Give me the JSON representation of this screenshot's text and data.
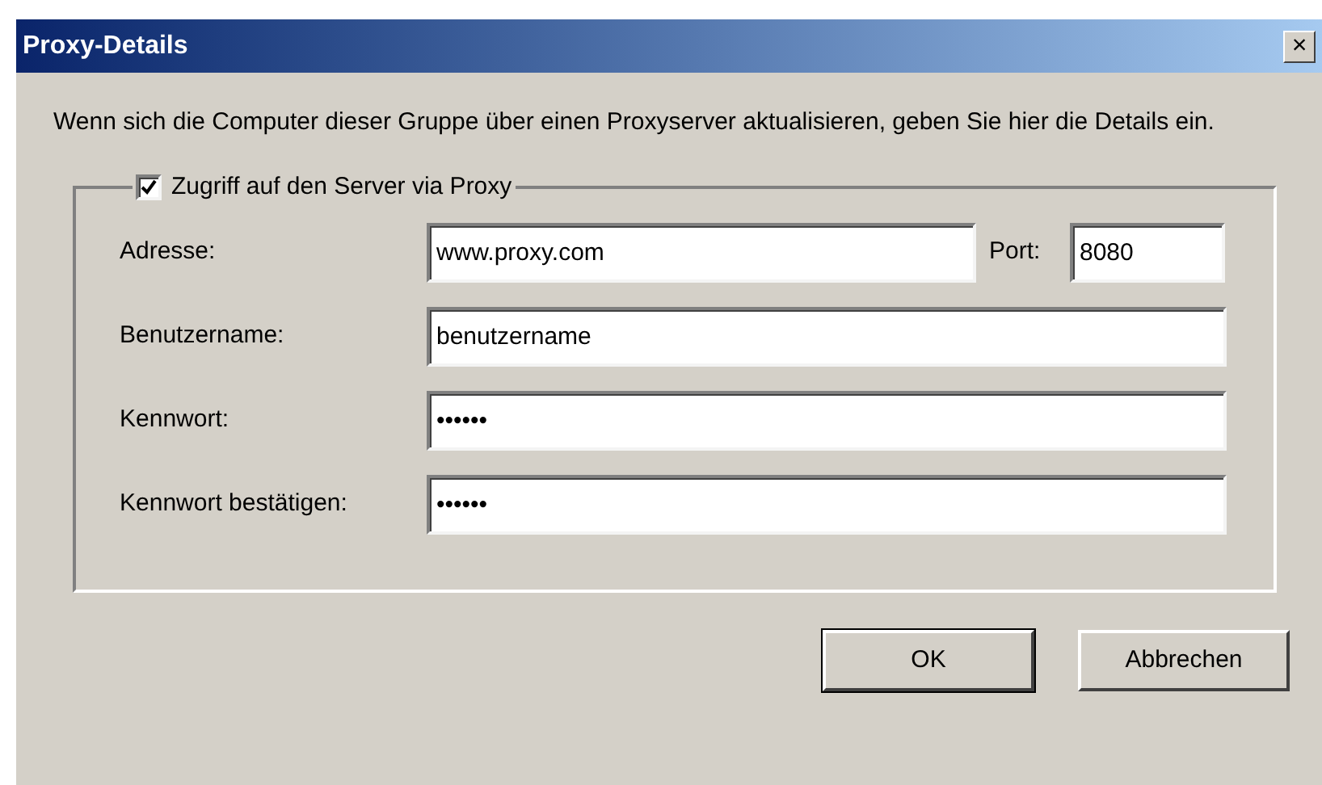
{
  "window": {
    "title": "Proxy-Details",
    "close": "×"
  },
  "description": "Wenn sich die Computer dieser Gruppe über einen Proxyserver aktualisieren, geben Sie hier die Details ein.",
  "group": {
    "label": "Zugriff auf den Server via Proxy",
    "checked": true
  },
  "fields": [
    {
      "label": "Adresse:",
      "value": "www.proxy.com",
      "port": {
        "label": "Port:",
        "value": "8080"
      }
    },
    {
      "label": "Benutzername:",
      "value": "benutzername"
    },
    {
      "label": "Kennwort:",
      "value": "••••••"
    },
    {
      "label": "Kennwort bestätigen:",
      "value": "••••••"
    }
  ],
  "buttons": [
    {
      "label": "OK",
      "kind": "default"
    },
    {
      "label": "Abbrechen",
      "kind": "normal"
    }
  ]
}
